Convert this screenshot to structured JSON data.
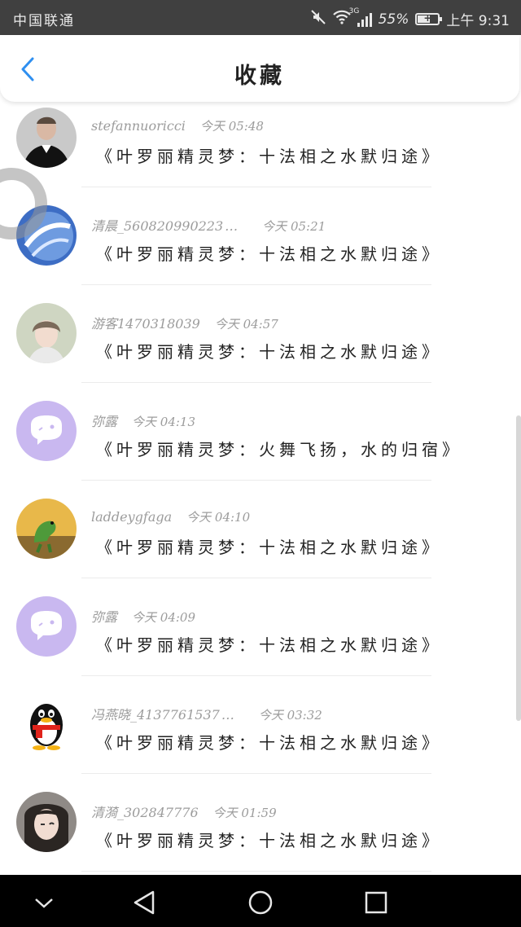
{
  "status_bar": {
    "carrier": "中国联通",
    "network": "3G",
    "battery": "55%",
    "time": "上午 9:31",
    "icons": [
      "mute-icon",
      "wifi-icon",
      "signal-icon",
      "battery-icon"
    ]
  },
  "header": {
    "title": "收藏",
    "back_icon": "chevron-left-icon",
    "accent": "#2f8ff0"
  },
  "items": [
    {
      "name": "stefannuoricci",
      "time": "今天 05:48",
      "content": "《叶罗丽精灵梦：十法相之水默归途》",
      "avatar": "photo-man-suit"
    },
    {
      "name": "清晨_560820990223",
      "ellipsis": "…",
      "time": "今天 05:21",
      "content": "《叶罗丽精灵梦：十法相之水默归途》",
      "avatar": "photo-blue-swirl"
    },
    {
      "name": "游客1470318039",
      "time": "今天 04:57",
      "content": "《叶罗丽精灵梦：十法相之水默归途》",
      "avatar": "photo-girl"
    },
    {
      "name": "弥露",
      "time": "今天 04:13",
      "content": "《叶罗丽精灵梦：火舞飞扬，水的归宿》",
      "avatar": "default-chat-avatar"
    },
    {
      "name": "laddeygfaga",
      "time": "今天 04:10",
      "content": "《叶罗丽精灵梦：十法相之水默归途》",
      "avatar": "photo-dinosaur"
    },
    {
      "name": "弥露",
      "time": "今天 04:09",
      "content": "《叶罗丽精灵梦：十法相之水默归途》",
      "avatar": "default-chat-avatar"
    },
    {
      "name": "冯燕晓_4137761537",
      "ellipsis": "…",
      "time": "今天 03:32",
      "content": "《叶罗丽精灵梦：十法相之水默归途》",
      "avatar": "qq-penguin"
    },
    {
      "name": "清漪_302847776",
      "time": "今天 01:59",
      "content": "《叶罗丽精灵梦：十法相之水默归途》",
      "avatar": "photo-girl-wink"
    }
  ],
  "nav_bar": {
    "icons": [
      "chevron-down-icon",
      "back-triangle-icon",
      "home-circle-icon",
      "recents-square-icon"
    ]
  }
}
